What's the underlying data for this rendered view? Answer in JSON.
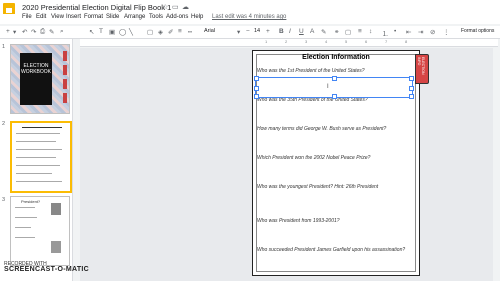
{
  "titlebar": {
    "doc_title": "2020 Presidential Election Digital Flip Book 1",
    "star_icon": "star-icon",
    "folder_icon": "folder-icon",
    "cloud_icon": "cloud-icon"
  },
  "menu": {
    "items": [
      "File",
      "Edit",
      "View",
      "Insert",
      "Format",
      "Slide",
      "Arrange",
      "Tools",
      "Add-ons",
      "Help"
    ],
    "last_edit": "Last edit was 4 minutes ago"
  },
  "toolbar": {
    "font": "Arial",
    "size": "14",
    "format_options": "Format options"
  },
  "ruler": {
    "numbers": [
      "1",
      "2",
      "3",
      "4",
      "5",
      "6",
      "7",
      "8"
    ]
  },
  "filmstrip": {
    "slide_numbers": [
      "1",
      "2",
      "3"
    ],
    "thumb1_text": "ELECTION WORKBOOK",
    "thumb3_title": "President?"
  },
  "slide": {
    "title": "Election Information",
    "side_tab_text": "ELECTION INFO",
    "questions": [
      "Who was the 1st President of the United States?",
      "Who was the 35th President of the United States?",
      "How many terms did George W. Bush serve as President?",
      "Which President won the 2002 Nobel Peace Prize?",
      "Who was the youngest President? Hint: 26th President",
      "Who was President from 1993-2001?",
      "Who succeeded President James Garfield upon his assassination?"
    ]
  },
  "watermark": {
    "line1": "RECORDED WITH",
    "line2": "SCREENCAST-O-MATIC"
  }
}
